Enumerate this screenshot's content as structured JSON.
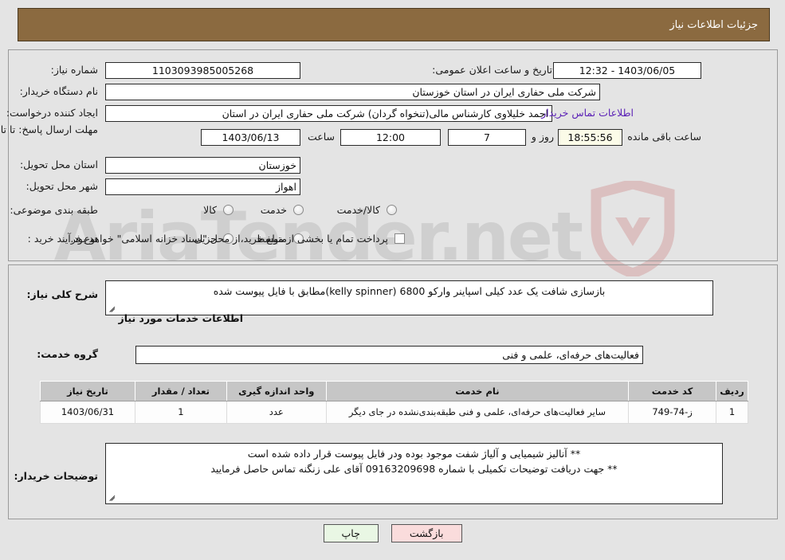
{
  "header": {
    "title": "جزئیات اطلاعات نیاز"
  },
  "watermark": {
    "text": "AriaTender.net"
  },
  "fields": {
    "need_number_label": "شماره نیاز:",
    "need_number_value": "1103093985005268",
    "public_announce_label": "تاریخ و ساعت اعلان عمومی:",
    "public_announce_value": "1403/06/05 - 12:32",
    "buyer_org_label": "نام دستگاه خریدار:",
    "buyer_org_value": "شرکت ملی حفاری ایران در استان خوزستان",
    "requester_label": "ایجاد کننده درخواست:",
    "requester_value": "احمد خلیلاوی کارشناس مالی(تنخواه گردان) شرکت ملی حفاری ایران در استان",
    "contact_link": "اطلاعات تماس خریدار",
    "deadline_label": "مهلت ارسال پاسخ: تا تاریخ:",
    "deadline_date": "1403/06/13",
    "hour_label": "ساعت",
    "deadline_time": "12:00",
    "days_value": "7",
    "days_label": "روز و",
    "countdown_value": "18:55:56",
    "countdown_label": "ساعت باقی مانده",
    "province_label": "استان محل تحویل:",
    "province_value": "خوزستان",
    "city_label": "شهر محل تحویل:",
    "city_value": "اهواز",
    "category_label": "طبقه بندی موضوعی:",
    "category_options": [
      "کالا",
      "خدمت",
      "کالا/خدمت"
    ],
    "process_label": "نوع فرآیند خرید :",
    "process_options": [
      "جزیی",
      "متوسط"
    ],
    "treasury_checkbox_text": "پرداخت تمام یا بخشی از مبلغ خرید،از محل \"اسناد خزانه اسلامی\" خواهد بود."
  },
  "description": {
    "label": "شرح کلی نیاز:",
    "value": "بازسازی شافت یک عدد کیلی اسپاینر وارکو 6800 (kelly spinner)مطابق با فایل پیوست شده"
  },
  "services_section": {
    "heading": "اطلاعات خدمات مورد نیاز",
    "group_label": "گروه خدمت:",
    "group_value": "فعالیت‌های حرفه‌ای، علمی و فنی"
  },
  "table": {
    "columns": [
      "ردیف",
      "کد خدمت",
      "نام خدمت",
      "واحد اندازه گیری",
      "تعداد / مقدار",
      "تاریخ نیاز"
    ],
    "rows": [
      {
        "index": "1",
        "code": "ز-74-749",
        "name": "سایر فعالیت‌های حرفه‌ای، علمی و فنی طبقه‌بندی‌نشده در جای دیگر",
        "unit": "عدد",
        "qty": "1",
        "date": "1403/06/31"
      }
    ]
  },
  "buyer_notes": {
    "label": "توضیحات خریدار:",
    "line1": "** آنالیز شیمیایی و آلیاژ شفت موجود بوده ودر فایل پیوست قرار داده شده است",
    "line2": "** جهت دریافت توضیحات تکمیلی با شماره 09163209698 آقای علی زنگنه تماس حاصل فرمایید"
  },
  "buttons": {
    "print": "چاپ",
    "back": "بازگشت"
  },
  "colors": {
    "header_band": "#8b6a40",
    "page_bg": "#e4e4e4",
    "link": "#5b21b6",
    "countdown_bg": "#fbfbe8",
    "btn_print_bg": "#e9f7e4",
    "btn_back_bg": "#fadcdc",
    "table_header_bg": "#c6c6c6"
  }
}
